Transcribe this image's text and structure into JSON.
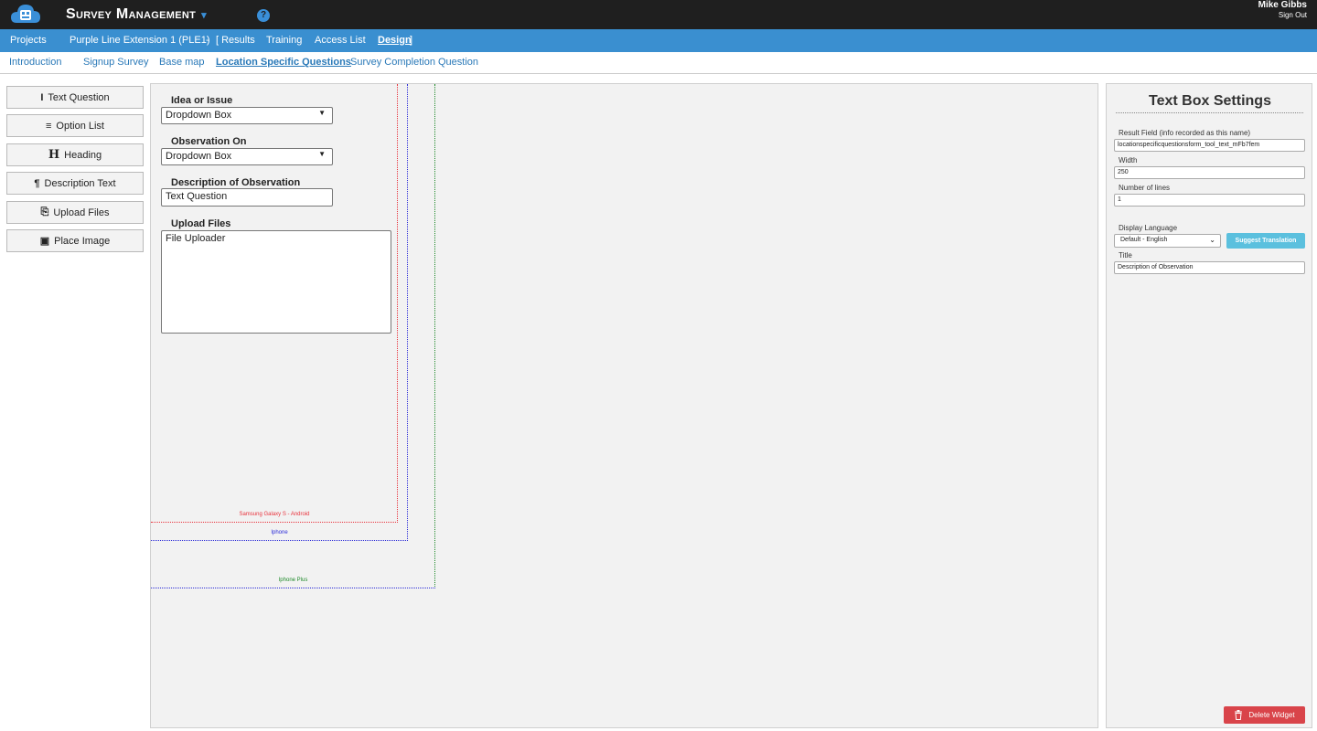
{
  "header": {
    "app_title": "Survey Management",
    "user_name": "Mike Gibbs",
    "sign_out": "Sign Out"
  },
  "project_nav": {
    "projects": "Projects",
    "project_name": "Purple Line Extension 1 (PLE1)",
    "separator": "-",
    "results": "[ Results",
    "training": "Training",
    "access_list": "Access List",
    "design": "Design",
    "close_bracket": "]"
  },
  "sub_nav": {
    "items": [
      "Introduction",
      "Signup Survey",
      "Base map",
      "Location Specific Questions",
      "Survey Completion Question"
    ],
    "active": "Location Specific Questions"
  },
  "tools": [
    {
      "icon": "text-cursor-icon",
      "glyph": "I",
      "label": "Text Question"
    },
    {
      "icon": "list-icon",
      "glyph": "≡",
      "label": "Option List"
    },
    {
      "icon": "heading-icon",
      "glyph": "H",
      "label": "Heading"
    },
    {
      "icon": "paragraph-icon",
      "glyph": "¶",
      "label": "Description Text"
    },
    {
      "icon": "upload-file-icon",
      "glyph": "⎘",
      "label": "Upload Files"
    },
    {
      "icon": "image-icon",
      "glyph": "▣",
      "label": "Place Image"
    }
  ],
  "form": {
    "fields": [
      {
        "label": "Idea or Issue",
        "value": "Dropdown Box"
      },
      {
        "label": "Observation On",
        "value": "Dropdown Box"
      },
      {
        "label": "Description of Observation",
        "value": "Text Question"
      },
      {
        "label": "Upload Files",
        "value": "File Uploader"
      }
    ]
  },
  "device_guides": {
    "samsung": "Samsung Galaxy S - Android",
    "iphone": "Iphone",
    "iphone_plus": "Iphone Plus",
    "colors": {
      "samsung": "#e8323c",
      "iphone": "#2a2ad8",
      "iphone_plus": "#1f8a2a"
    }
  },
  "settings": {
    "title": "Text Box Settings",
    "result_field_label": "Result Field (info recorded as this name)",
    "result_field_value": "locationspecificquestionsform_tool_text_mFb7fem",
    "width_label": "Width",
    "width_value": "250",
    "lines_label": "Number of lines",
    "lines_value": "1",
    "language_label": "Display Language",
    "language_value": "Default - English",
    "suggest_button": "Suggest Translation",
    "title_label": "Title",
    "title_value": "Description of Observation",
    "delete_button": "Delete Widget"
  },
  "colors": {
    "topbar": "#1f1f1f",
    "nav_blue": "#3a8fd0",
    "link_blue": "#2a79b8",
    "suggest": "#5bc0de",
    "delete": "#d9444a"
  }
}
